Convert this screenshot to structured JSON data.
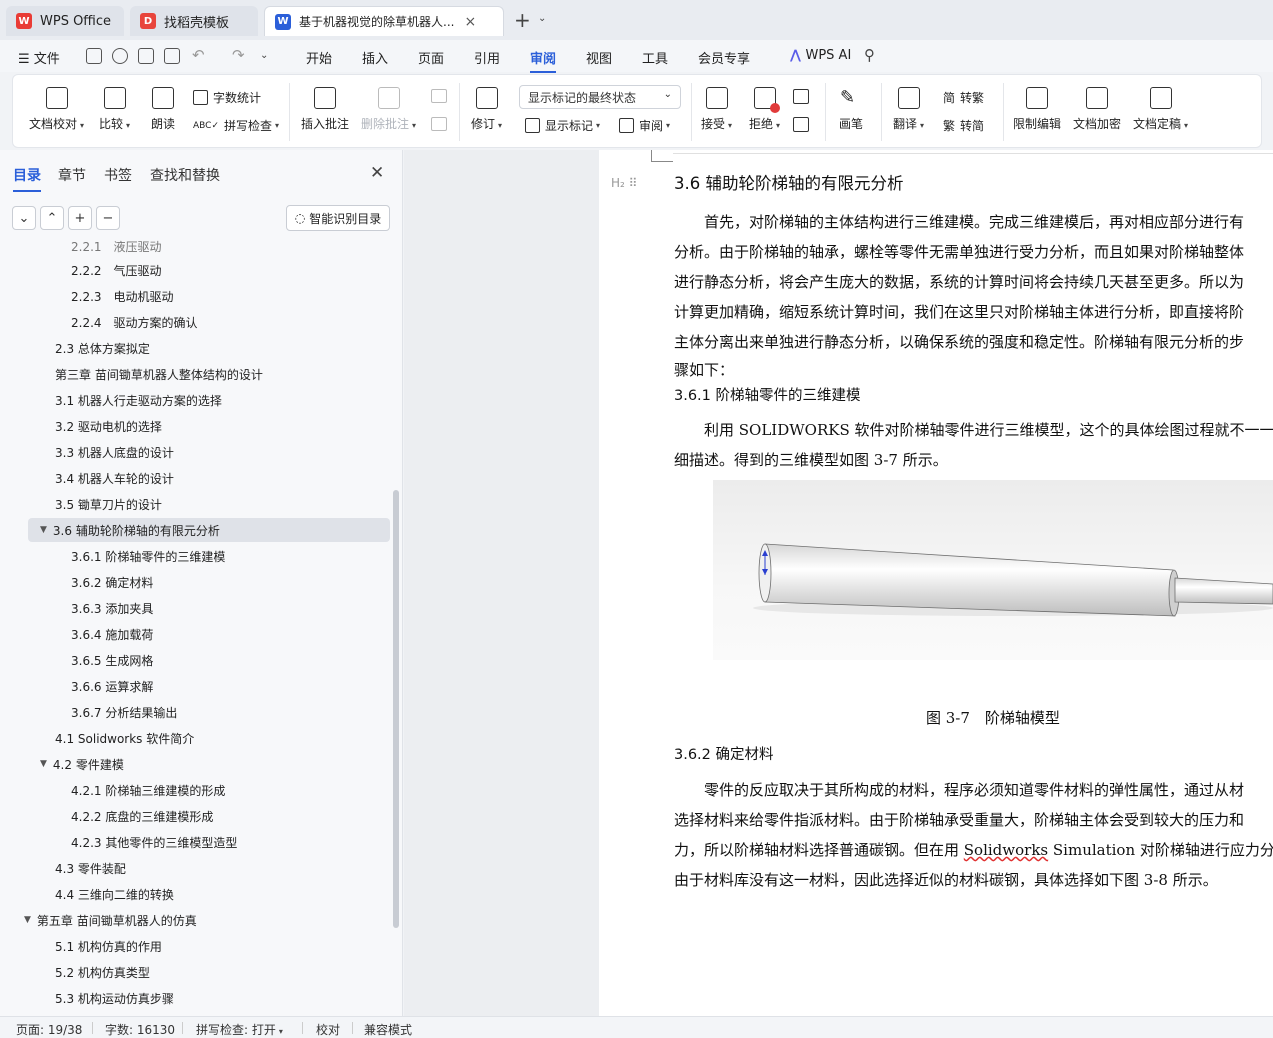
{
  "tabs": [
    {
      "label": "WPS Office"
    },
    {
      "label": "找稻壳模板"
    },
    {
      "label": "基于机器视觉的除草机器人..."
    }
  ],
  "menu": {
    "file": "文件",
    "items": [
      "开始",
      "插入",
      "页面",
      "引用",
      "审阅",
      "视图",
      "工具",
      "会员专享"
    ],
    "ai": "WPS AI"
  },
  "ribbon": {
    "proofread": "文档校对",
    "compare": "比较",
    "read": "朗读",
    "wordcount": "字数统计",
    "spell": "拼写检查",
    "insert_comment": "插入批注",
    "delete_comment": "删除批注",
    "revise": "修订",
    "markup_state": "显示标记的最终状态",
    "show_markup": "显示标记",
    "review_pane": "审阅",
    "accept": "接受",
    "reject": "拒绝",
    "pen": "画笔",
    "translate": "翻译",
    "to_trad": "转繁",
    "to_simp": "转简",
    "restrict": "限制编辑",
    "encrypt": "文档加密",
    "finalize": "文档定稿"
  },
  "nav": {
    "tabs": [
      "目录",
      "章节",
      "书签",
      "查找和替换"
    ],
    "smart": "智能识别目录",
    "toc": [
      "2.2.1　液压驱动",
      "2.2.2　气压驱动",
      "2.2.3　电动机驱动",
      "2.2.4　驱动方案的确认",
      "2.3  总体方案拟定",
      "第三章  苗间锄草机器人整体结构的设计",
      "3.1 机器人行走驱动方案的选择",
      "3.2 驱动电机的选择",
      "3.3 机器人底盘的设计",
      "3.4  机器人车轮的设计",
      "3.5 锄草刀片的设计",
      "3.6  辅助轮阶梯轴的有限元分析",
      "3.6.1  阶梯轴零件的三维建模",
      "3.6.2  确定材料",
      "3.6.3  添加夹具",
      "3.6.4  施加载荷",
      "3.6.5  生成网格",
      "3.6.6  运算求解",
      "3.6.7  分析结果输出",
      "4.1 Solidworks 软件简介",
      "4.2  零件建模",
      "4.2.1 阶梯轴三维建模的形成",
      "4.2.2  底盘的三维建模形成",
      "4.2.3 其他零件的三维模型造型",
      "4.3 零件装配",
      "4.4 三维向二维的转换",
      "第五章  苗间锄草机器人的仿真",
      "5.1 机构仿真的作用",
      "5.2 机构仿真类型",
      "5.3 机构运动仿真步骤"
    ]
  },
  "doc": {
    "h2": "3.6  辅助轮阶梯轴的有限元分析",
    "p1": [
      "首先，对阶梯轴的主体结构进行三维建模。完成三维建模后，再对相应部分进行有",
      "分析。由于阶梯轴的轴承，螺栓等零件无需单独进行受力分析，而且如果对阶梯轴整体",
      "进行静态分析，将会产生庞大的数据，系统的计算时间将会持续几天甚至更多。所以为",
      "计算更加精确，缩短系统计算时间，我们在这里只对阶梯轴主体进行分析，即直接将阶",
      "主体分离出来单独进行静态分析，以确保系统的强度和稳定性。阶梯轴有限元分析的步",
      "骤如下："
    ],
    "h3a": "3.6.1  阶梯轴零件的三维建模",
    "p2": [
      "利用 SOLIDWORKS 软件对阶梯轴零件进行三维模型，这个的具体绘图过程就不一一",
      "细描述。得到的三维模型如图 3-7 所示。"
    ],
    "caption": "图 3-7　阶梯轴模型",
    "h3b": "3.6.2  确定材料",
    "p3": [
      "零件的反应取决于其所构成的材料，程序必须知道零件材料的弹性属性，通过从材",
      "选择材料来给零件指派材料。由于阶梯轴承受重量大，阶梯轴主体会受到较大的压力和",
      "力，所以阶梯轴材料选择普通碳钢。但在用 ",
      "由于材料库没有这一材料，因此选择近似的材料碳钢，具体选择如下图 3-8 所示。"
    ],
    "p3_2": null
  },
  "status": {
    "page": "页面: 19/38",
    "words": "字数: 16130",
    "spell": "拼写检查: 打开",
    "proof": "校对",
    "compat": "兼容模式"
  },
  "colors": {
    "accent": "#2b5fd9",
    "selection": "#dfe2e8",
    "wps_red": "#e93b35"
  }
}
